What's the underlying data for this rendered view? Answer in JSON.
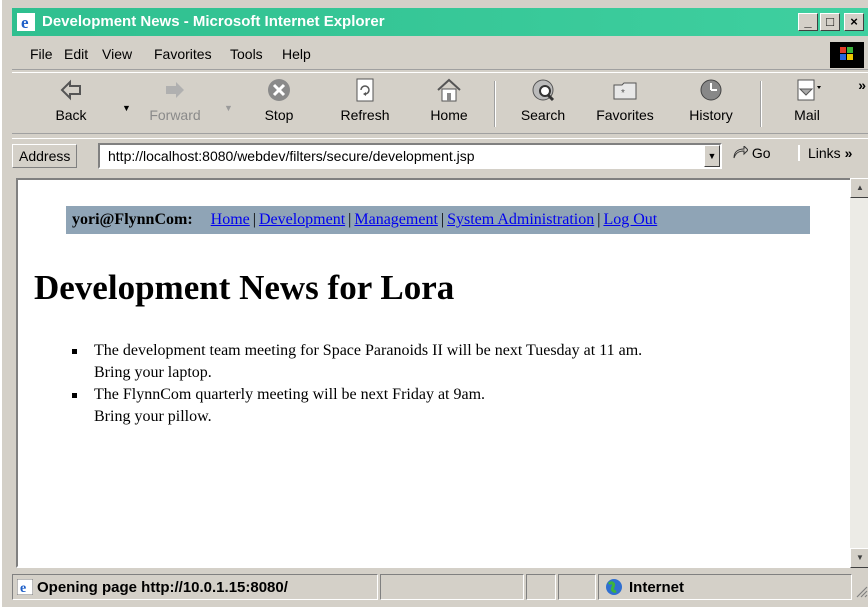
{
  "window": {
    "title": "Development News - Microsoft Internet Explorer",
    "title_bar_color": "#2fbf8f",
    "controls": {
      "minimize": "_",
      "maximize": "□",
      "close": "×"
    }
  },
  "menu": [
    "File",
    "Edit",
    "View",
    "Favorites",
    "Tools",
    "Help"
  ],
  "toolbar": {
    "back": "Back",
    "forward": "Forward",
    "stop": "Stop",
    "refresh": "Refresh",
    "home": "Home",
    "search": "Search",
    "favorites": "Favorites",
    "history": "History",
    "mail": "Mail",
    "overflow": "»"
  },
  "address": {
    "label": "Address",
    "url": "http://localhost:8080/webdev/filters/secure/development.jsp",
    "go": "Go",
    "links": "Links",
    "links_overflow": "»"
  },
  "page": {
    "nav_user": "yori@FlynnCom:",
    "nav_links": [
      "Home",
      "Development",
      "Management",
      "System Administration",
      "Log Out"
    ],
    "nav_separator": "|",
    "nav_bg_color": "#8fa4b6",
    "title": "Development News for Lora",
    "news": [
      {
        "line1": "The development team meeting for Space Paranoids II will be next Tuesday at 11 am.",
        "line2": "Bring your laptop."
      },
      {
        "line1": "The FlynnCom quarterly meeting will be next Friday at 9am.",
        "line2": "Bring your pillow."
      }
    ]
  },
  "status": {
    "text": "Opening page http://10.0.1.15:8080/",
    "zone": "Internet"
  }
}
